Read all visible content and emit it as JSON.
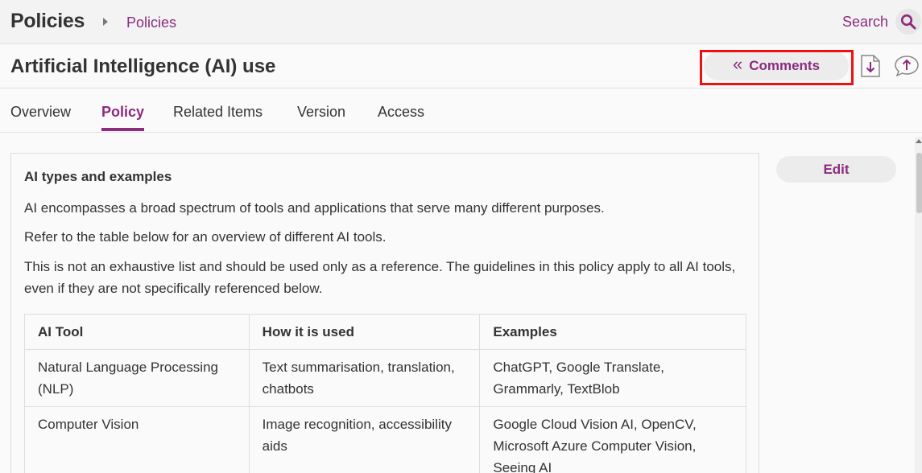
{
  "topbar": {
    "app_title": "Policies",
    "breadcrumb": "Policies",
    "search_label": "Search",
    "search_icon": "search-icon"
  },
  "document": {
    "title": "Artificial Intelligence (AI) use",
    "comments_chevron": "«",
    "comments_label": "Comments",
    "download_icon": "download-icon",
    "upload_icon": "upload-comment-icon"
  },
  "tabs": [
    {
      "label": "Overview",
      "active": false
    },
    {
      "label": "Policy",
      "active": true
    },
    {
      "label": "Related Items",
      "active": false
    },
    {
      "label": "Version",
      "active": false
    },
    {
      "label": "Access",
      "active": false
    }
  ],
  "content": {
    "heading": "AI types and examples",
    "paragraphs": [
      "AI encompasses a broad spectrum of tools and applications that serve many different purposes.",
      "Refer to the table below for an overview of different AI tools.",
      "This is not an exhaustive list and should be used only as a reference. The guidelines in this policy apply to all AI tools, even if they are not specifically referenced below."
    ],
    "table": {
      "headers": [
        "AI Tool",
        "How it is used",
        "Examples"
      ],
      "rows": [
        [
          "Natural Language Processing (NLP)",
          "Text summarisation, translation, chatbots",
          "ChatGPT, Google Translate, Grammarly, TextBlob"
        ],
        [
          "Computer Vision",
          "Image recognition, accessibility aids",
          "Google Cloud Vision AI, OpenCV, Microsoft Azure Computer Vision, Seeing AI"
        ]
      ]
    }
  },
  "sidebar": {
    "edit_label": "Edit"
  },
  "colors": {
    "accent": "#8c2b7e",
    "highlight": "#e11111"
  }
}
